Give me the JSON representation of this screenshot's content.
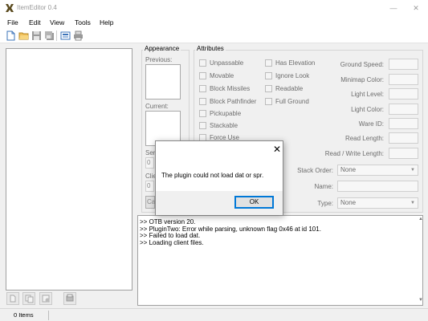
{
  "window": {
    "title": "ItemEditor 0.4",
    "minimize": "—",
    "close": "✕"
  },
  "menu": {
    "items": [
      "File",
      "Edit",
      "View",
      "Tools",
      "Help"
    ]
  },
  "appearance": {
    "title": "Appearance",
    "previous_label": "Previous:",
    "current_label": "Current:",
    "server_id_label": "Ser",
    "server_id_value": "0",
    "client_id_label": "Clie",
    "client_id_value": "0",
    "candidates_label": "Ca"
  },
  "attributes": {
    "title": "Attributes",
    "checkboxes_left": [
      "Unpassable",
      "Movable",
      "Block Missiles",
      "Block Pathfinder",
      "Pickupable",
      "Stackable",
      "Force Use"
    ],
    "checkboxes_right": [
      "Has Elevation",
      "Ignore Look",
      "Readable",
      "Full Ground"
    ],
    "fields": [
      "Ground Speed:",
      "Minimap Color:",
      "Light Level:",
      "Light Color:",
      "Ware ID:",
      "Read Length:",
      "Read / Write Length:"
    ],
    "stack_order_label": "Stack Order:",
    "stack_order_value": "None",
    "name_label": "Name:",
    "type_label": "Type:",
    "type_value": "None"
  },
  "log": {
    "lines": [
      ">> OTB version 20.",
      ">> PluginTwo: Error while parsing, unknown flag 0x46 at id 101.",
      ">> Failed to load dat.",
      ">> Loading client files."
    ]
  },
  "dialog": {
    "message": "The plugin could not load dat or spr.",
    "ok_label": "OK",
    "close_glyph": "✕"
  },
  "status": {
    "items_count": "0 Items"
  }
}
